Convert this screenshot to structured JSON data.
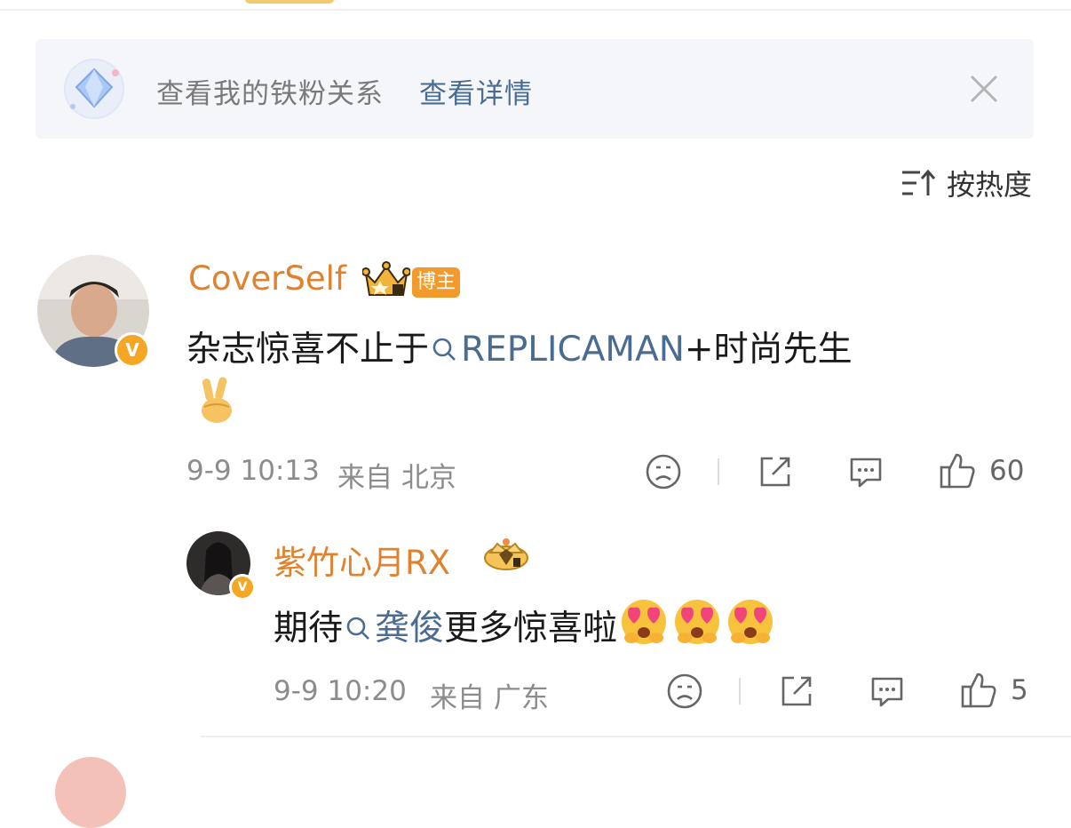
{
  "banner": {
    "text": "查看我的铁粉关系",
    "link": "查看详情"
  },
  "sort": {
    "label": "按热度"
  },
  "comments": [
    {
      "user": "CoverSelf",
      "badge": "博主",
      "text_prefix": "杂志惊喜不止于",
      "topic": "REPLICAMAN",
      "text_suffix": "+时尚先生",
      "timestamp": "9-9 10:13",
      "location": "来自 北京",
      "likes": "60"
    }
  ],
  "replies": [
    {
      "user": "紫竹心月RX",
      "text_prefix": "期待",
      "topic": "龚俊",
      "text_suffix": "更多惊喜啦",
      "timestamp": "9-9 10:20",
      "location": "来自 广东",
      "likes": "5"
    }
  ],
  "icons": {
    "verified_badge": "V"
  },
  "colors": {
    "username": "#e0812e",
    "topic_link": "#4a6b92",
    "badge": "#f39a2c"
  }
}
